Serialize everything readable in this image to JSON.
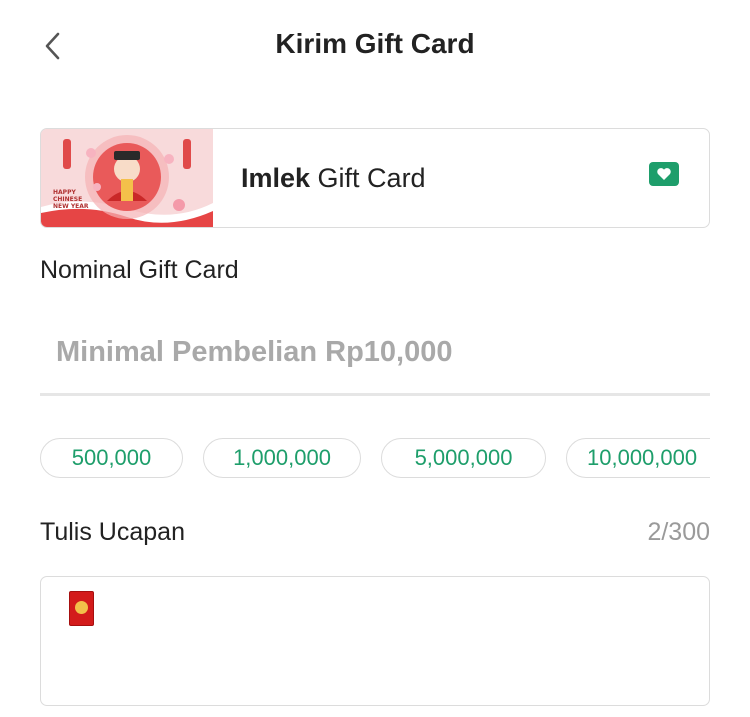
{
  "header": {
    "title": "Kirim Gift Card"
  },
  "card": {
    "name_bold": "Imlek",
    "name_rest": " Gift Card",
    "thumb_caption": [
      "HAPPY",
      "CHINESE",
      "NEW YEAR"
    ]
  },
  "nominal": {
    "label": "Nominal Gift Card",
    "placeholder": "Minimal Pembelian Rp10,000",
    "value": ""
  },
  "amounts": [
    "500,000",
    "1,000,000",
    "5,000,000",
    "10,000,000"
  ],
  "message": {
    "label": "Tulis Ucapan",
    "counter": "2/300"
  },
  "colors": {
    "accent": "#1e9e6b",
    "border": "#dcdcdc",
    "placeholder": "#a9a9a9"
  }
}
